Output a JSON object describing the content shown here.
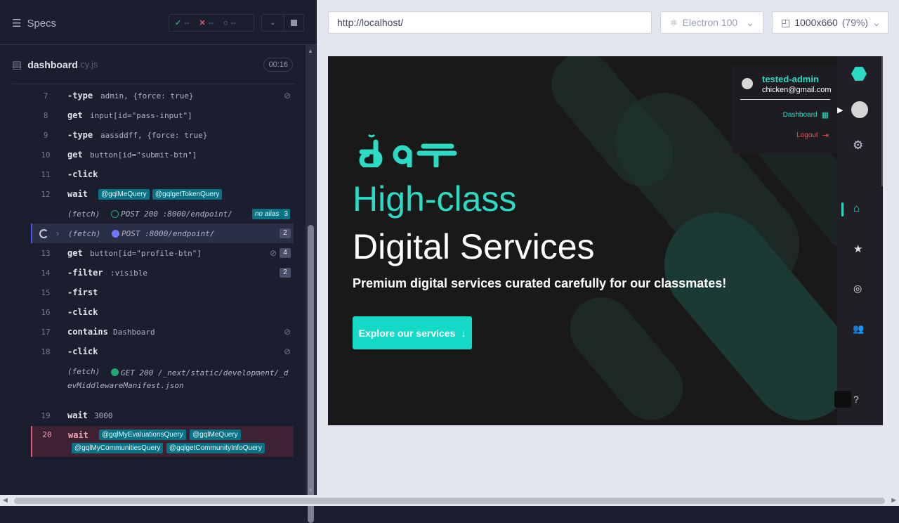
{
  "runner": {
    "specs_label": "Specs",
    "passed": "--",
    "failed": "--",
    "pending": "--",
    "spec_file": "dashboard",
    "spec_ext": ".cy.js",
    "timer": "00:16"
  },
  "commands": [
    {
      "num": "7",
      "name": "-type",
      "msg": "admin, {force: true}",
      "eye": true
    },
    {
      "num": "8",
      "name": "get",
      "msg": "input[id=\"pass-input\"]"
    },
    {
      "num": "9",
      "name": "-type",
      "msg": "aassddff, {force: true}"
    },
    {
      "num": "10",
      "name": "get",
      "msg": "button[id=\"submit-btn\"]"
    },
    {
      "num": "11",
      "name": "-click",
      "msg": ""
    },
    {
      "num": "12",
      "name": "wait",
      "aliases": [
        "@gqlMeQuery",
        "@gqlgetTokenQuery"
      ]
    },
    {
      "num": "",
      "name": "(fetch)",
      "msg": "POST 200 :8000/endpoint/",
      "badge": "no alias",
      "count": "3"
    },
    {
      "num": "",
      "name": "(fetch)",
      "msg": "POST :8000/endpoint/",
      "count": "2"
    },
    {
      "num": "13",
      "name": "get",
      "msg": "button[id=\"profile-btn\"]",
      "count": "4",
      "eye": true
    },
    {
      "num": "14",
      "name": "-filter",
      "msg": ":visible",
      "count": "2"
    },
    {
      "num": "15",
      "name": "-first",
      "msg": ""
    },
    {
      "num": "16",
      "name": "-click",
      "msg": ""
    },
    {
      "num": "17",
      "name": "contains",
      "msg": "Dashboard",
      "eye": true
    },
    {
      "num": "18",
      "name": "-click",
      "msg": "",
      "eye": true
    },
    {
      "num": "",
      "name": "(fetch)",
      "msg": "GET 200 /_next/static/development/_devMiddlewareManifest.json"
    },
    {
      "num": "19",
      "name": "wait",
      "msg": "3000"
    },
    {
      "num": "20",
      "name": "wait",
      "aliases": [
        "@gqlMyEvaluationsQuery",
        "@gqlMeQuery",
        "@gqlMyCommunitiesQuery",
        "@gqlgetCommunityInfoQuery"
      ]
    }
  ],
  "browser": {
    "url": "http://localhost/",
    "browser_name": "Electron 100",
    "viewport": "1000x660",
    "zoom": "(79%)"
  },
  "app": {
    "headline_1": "High-class",
    "headline_2": "Digital Services",
    "subtitle": "Premium digital services curated carefully for our classmates!",
    "cta": "Explore our services",
    "menu_user": "tested-admin",
    "menu_email": "chicken@gmail.com",
    "menu_dashboard": "Dashboard",
    "menu_logout": "Logout"
  },
  "colors": {
    "accent": "#2ddbc4",
    "cta": "#14d9c7",
    "alias": "#0b7285",
    "error_row": "#3d2233",
    "logout": "#e05555"
  }
}
